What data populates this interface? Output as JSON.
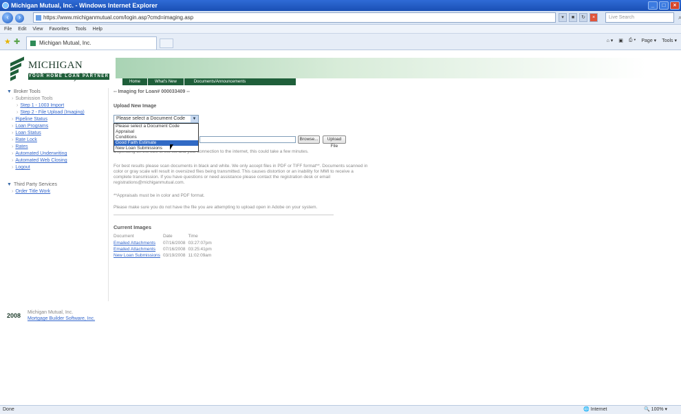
{
  "browser": {
    "title": "Michigan Mutual, Inc. - Windows Internet Explorer",
    "address": "https://www.michiganmutual.com/login.asp?cmd=imaging.asp",
    "search_placeholder": "Live Search",
    "menu": [
      "File",
      "Edit",
      "View",
      "Favorites",
      "Tools",
      "Help"
    ],
    "tab_label": "Michigan Mutual, Inc.",
    "command_bar": [
      "Page ▾",
      "Tools ▾"
    ],
    "status_left": "Done",
    "status_zone": "Internet",
    "status_zoom": "100%"
  },
  "site": {
    "logo_name": "MICHIGAN MUTUAL, INC.",
    "logo_tagline": "YOUR HOME LOAN PARTNER",
    "nav": [
      "Home",
      "What's New",
      "Documents/Announcements"
    ]
  },
  "sidebar": {
    "broker_tools": "Broker Tools",
    "submission_tools": "Submission Tools",
    "step1": "Step 1 - 1003 Import",
    "step2": "Step 2 - File Upload (Imaging)",
    "items": [
      "Pipeline Status",
      "Loan Programs",
      "Loan Status",
      "Rate Lock",
      "Rates",
      "Automated Underwriting",
      "Automated Web Closing",
      "Logout"
    ],
    "third_party": "Third Party Services",
    "order_title": "Order Title Work"
  },
  "footer": {
    "year": "2008",
    "company": "Michigan Mutual, Inc.",
    "link": "Mortgage Builder Software, Inc."
  },
  "main": {
    "breadcrumb": "-- Imaging for Loan# 000033409 --",
    "upload_heading": "Upload New Image",
    "select_value": "Please select a Document Code",
    "options": [
      "Please select a Document Code",
      "Appraisal",
      "Conditions",
      "Good Faith Estimate",
      "New Loan Submissions"
    ],
    "browse_label": "Browse...",
    "upload_label": "Upload File",
    "note1": "Depending on the size of the file and your connection to the internet, this could take a few minutes.",
    "note2": "For best results please scan documents in black and white. We only accept files in PDF or TIFF format**. Documents scanned in color or gray scale will result in oversized files being transmitted. This causes distortion or an inability for MMI to receive a complete transmission. If you have questions or need assistance please contact the registration desk or email registrations@michiganmutual.com.",
    "note3": "**Appraisals must be in color and PDF format.",
    "note4": "Please make sure you do not have the file you are attempting to upload open in Adobe on your system.",
    "current_heading": "Current Images",
    "table_headers": [
      "Document",
      "Date",
      "Time"
    ],
    "rows": [
      {
        "doc": "Emailed Attachments",
        "date": "07/16/2008",
        "time": "03:27:07pm"
      },
      {
        "doc": "Emailed Attachments",
        "date": "07/16/2008",
        "time": "03:25:41pm"
      },
      {
        "doc": "New Loan Submissions",
        "date": "03/19/2008",
        "time": "11:02:09am"
      }
    ]
  }
}
